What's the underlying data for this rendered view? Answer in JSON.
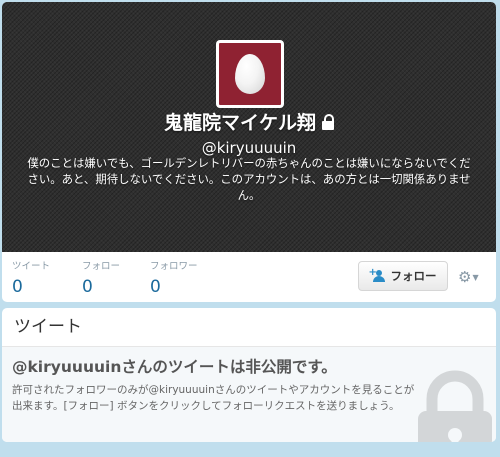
{
  "profile": {
    "name": "鬼龍院マイケル翔",
    "handle": "@kiryuuuuin",
    "bio": "僕のことは嫌いでも、ゴールデンレトリバーの赤ちゃんのことは嫌いにならないでください。あと、期待しないでください。このアカウントは、あの方とは一切関係ありません。",
    "protected_icon": "lock-icon",
    "avatar_icon": "default-egg-avatar"
  },
  "stats": [
    {
      "label": "ツイート",
      "value": "0"
    },
    {
      "label": "フォロー",
      "value": "0"
    },
    {
      "label": "フォロワー",
      "value": "0"
    }
  ],
  "actions": {
    "follow_label": "フォロー",
    "follow_icon": "person-plus-icon",
    "settings_icon": "gear-icon"
  },
  "tweets": {
    "title": "ツイート",
    "protected_title": "@kiryuuuuinさんのツイートは非公開です。",
    "protected_text": "許可されたフォロワーのみが@kiryuuuuinさんのツイートやアカウントを見ることが出来ます。[フォロー] ボタンをクリックしてフォローリクエストを送りましょう。"
  },
  "colors": {
    "background": "#c0deed",
    "link": "#1b6a9c",
    "avatar_bg": "#8f2232",
    "header_bg": "#2f2f2f"
  }
}
